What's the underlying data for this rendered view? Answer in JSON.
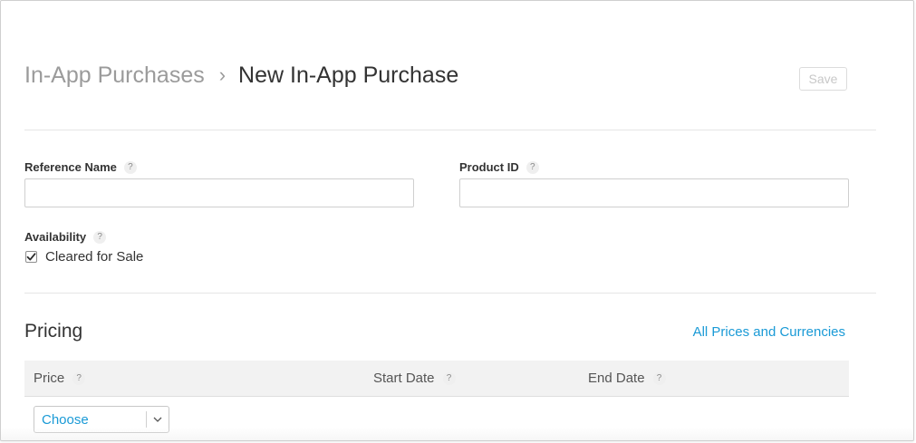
{
  "header": {
    "breadcrumb_parent": "In-App Purchases",
    "breadcrumb_separator": "›",
    "breadcrumb_current": "New In-App Purchase",
    "save_label": "Save"
  },
  "form": {
    "reference_name": {
      "label": "Reference Name",
      "help": "?",
      "value": ""
    },
    "product_id": {
      "label": "Product ID",
      "help": "?",
      "value": ""
    },
    "availability": {
      "label": "Availability",
      "help": "?",
      "checkbox_label": "Cleared for Sale",
      "checked": true
    }
  },
  "pricing": {
    "title": "Pricing",
    "link": "All Prices and Currencies",
    "columns": [
      {
        "label": "Price",
        "help": "?"
      },
      {
        "label": "Start Date",
        "help": "?"
      },
      {
        "label": "End Date",
        "help": "?"
      }
    ],
    "price_select": {
      "value": "Choose"
    }
  },
  "colors": {
    "accent": "#1a9ad6",
    "muted_text": "#9b9b9b",
    "table_header_bg": "#f2f2f2"
  }
}
